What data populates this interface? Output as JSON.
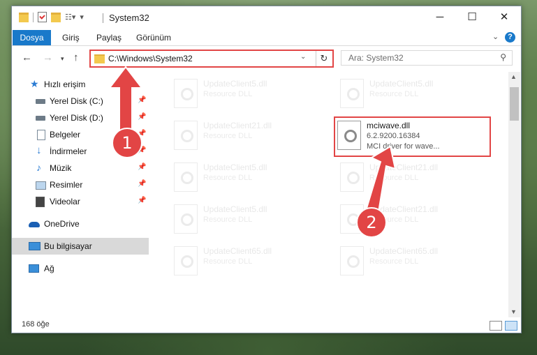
{
  "window": {
    "title": "System32",
    "controls": {
      "minimize": "─",
      "maximize": "☐",
      "close": "✕"
    }
  },
  "ribbon": {
    "tabs": [
      "Dosya",
      "Giriş",
      "Paylaş",
      "Görünüm"
    ]
  },
  "navigation": {
    "address": "C:\\Windows\\System32",
    "search_placeholder": "Ara: System32"
  },
  "sidebar": {
    "quick_access": "Hızlı erişim",
    "items": [
      {
        "label": "Yerel Disk (C:)",
        "icon": "drive-icon"
      },
      {
        "label": "Yerel Disk (D:)",
        "icon": "drive-icon"
      },
      {
        "label": "Belgeler",
        "icon": "documents-icon"
      },
      {
        "label": "İndirmeler",
        "icon": "download-icon"
      },
      {
        "label": "Müzik",
        "icon": "music-icon"
      },
      {
        "label": "Resimler",
        "icon": "pictures-icon"
      },
      {
        "label": "Videolar",
        "icon": "video-icon"
      }
    ],
    "onedrive": "OneDrive",
    "this_pc": "Bu bilgisayar",
    "network": "Ağ"
  },
  "files": {
    "left": [
      {
        "name": "UpdateClient5.dll",
        "type": "Resource DLL"
      },
      {
        "name": "UpdateClient21.dll",
        "type": "Resource DLL"
      },
      {
        "name": "UpdateClient5.dll",
        "type": "Resource DLL"
      },
      {
        "name": "UpdateClient5.dll",
        "type": "Resource DLL"
      },
      {
        "name": "UpdateClient65.dll",
        "type": "Resource DLL"
      }
    ],
    "right": [
      {
        "name": "UpdateClient5.dll",
        "type": "Resource DLL"
      },
      {
        "name": "UpdateClient21.dll",
        "type": "Resource DLL"
      },
      {
        "name": "UpdateClient21.dll",
        "type": "Resource DLL"
      },
      {
        "name": "UpdateClient65.dll",
        "type": "Resource DLL"
      }
    ],
    "highlighted": {
      "name": "mciwave.dll",
      "version": "6.2.9200.16384",
      "description": "MCI driver for wave..."
    }
  },
  "status": {
    "count": "168 öğe"
  },
  "annotations": {
    "step1": "1",
    "step2": "2",
    "color": "#e24545"
  }
}
